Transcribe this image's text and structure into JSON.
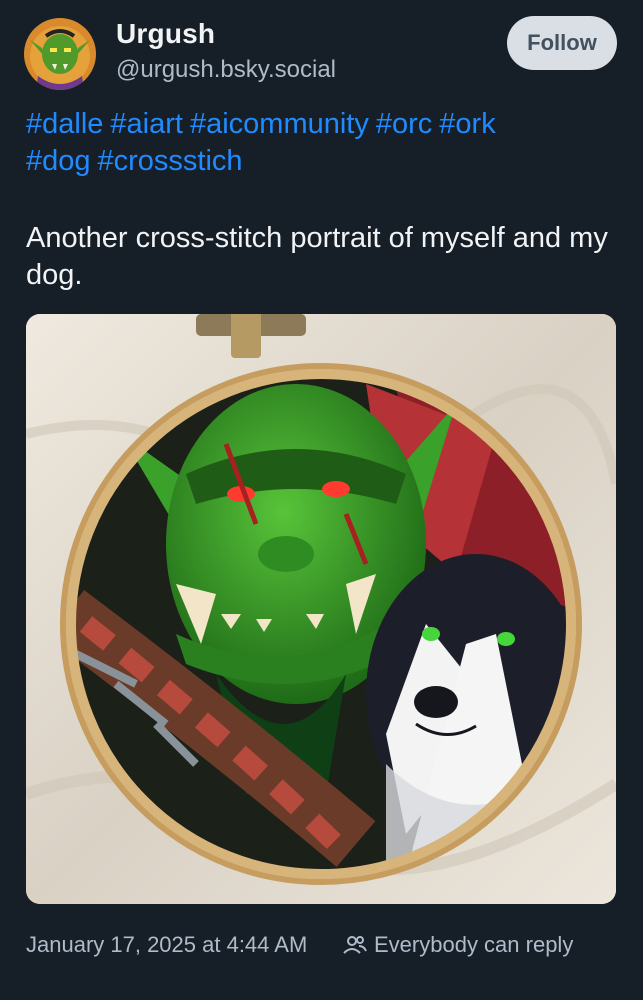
{
  "author": {
    "display_name": "Urgush",
    "handle": "@urgush.bsky.social",
    "avatar_icon": "orc-avatar-icon"
  },
  "follow_label": "Follow",
  "hashtags": [
    "#dalle",
    "#aiart",
    "#aicommunity",
    "#orc",
    "#ork",
    "#dog",
    "#crossstich"
  ],
  "post_text": "Another cross-stitch portrait of myself and my dog.",
  "image": {
    "subject": "cross-stitch embroidery hoop with green orc and black-and-white border collie"
  },
  "footer": {
    "timestamp": "January 17, 2025 at 4:44 AM",
    "reply_setting": "Everybody can reply",
    "reply_icon": "people-icon"
  },
  "colors": {
    "background": "#161e27",
    "link": "#208bfe",
    "text": "#f1f3f5",
    "muted": "#aebbc9",
    "follow_bg": "#d9dfe5"
  }
}
